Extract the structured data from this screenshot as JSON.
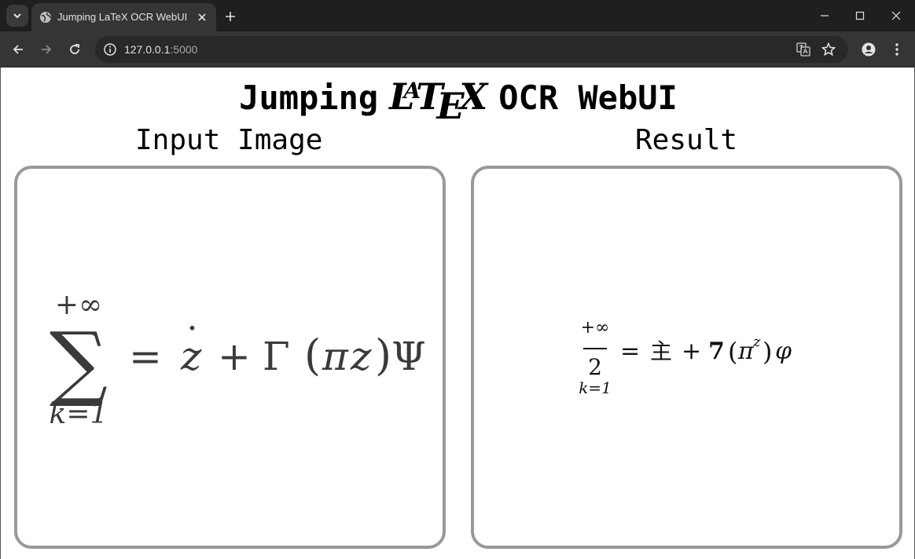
{
  "browser": {
    "tab_title": "Jumping LaTeX OCR WebUI",
    "url_host": "127.0.0.1",
    "url_port": ":5000",
    "icons": [
      "tab-search-icon",
      "globe-icon",
      "close-icon",
      "plus-icon",
      "minimize-icon",
      "maximize-icon",
      "close-window-icon",
      "back-icon",
      "forward-icon",
      "reload-icon",
      "info-icon",
      "translate-icon",
      "star-icon",
      "profile-icon",
      "kebab-menu-icon"
    ]
  },
  "page": {
    "title_prefix": "Jumping",
    "title_logo": {
      "L": "L",
      "A": "A",
      "T": "T",
      "E": "E",
      "X": "X"
    },
    "title_suffix": "OCR WebUI",
    "input_label": "Input Image",
    "result_label": "Result"
  },
  "input_formula": {
    "upper": "+∞",
    "sigma": "∑",
    "lower": "k=1",
    "eq": "=",
    "zdot_dot": "˙",
    "z": "z",
    "plus": "+",
    "gamma": "Γ",
    "lparen": "(",
    "pi": "π",
    "z2": "z",
    "rparen": ")",
    "psi": "Ψ"
  },
  "result_formula": {
    "upper": "+∞",
    "two": "2",
    "lower": "k=1",
    "eq": "=",
    "zhu": "主",
    "plus": "+",
    "seven": "7",
    "lparen": "(",
    "pi": "π",
    "sup_z": "z",
    "rparen": ")",
    "phi": "φ"
  },
  "colors": {
    "titlebar": "#1f1f1f",
    "toolbar": "#353535",
    "panel_border": "#999999"
  }
}
